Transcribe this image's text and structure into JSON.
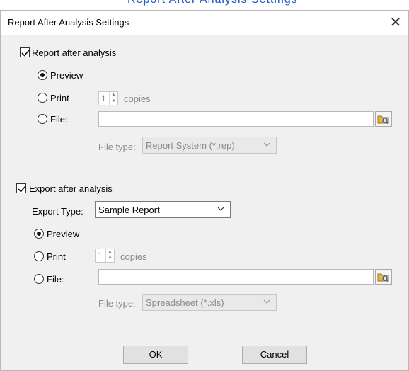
{
  "header_clip": "Report After Analysis Settings",
  "dialog": {
    "title": "Report After Analysis Settings",
    "close_glyph": "✕"
  },
  "report": {
    "checkbox_label": "Report after analysis",
    "checked": true,
    "preview_label": "Preview",
    "print_label": "Print",
    "copies_value": "1",
    "copies_label": "copies",
    "file_label": "File:",
    "file_value": "",
    "file_type_label": "File type:",
    "file_type_value": "Report System (*.rep)"
  },
  "export": {
    "checkbox_label": "Export after analysis",
    "checked": true,
    "export_type_label": "Export Type:",
    "export_type_value": "Sample Report",
    "preview_label": "Preview",
    "print_label": "Print",
    "copies_value": "1",
    "copies_label": "copies",
    "file_label": "File:",
    "file_value": "",
    "file_type_label": "File type:",
    "file_type_value": "Spreadsheet (*.xls)"
  },
  "buttons": {
    "ok": "OK",
    "cancel": "Cancel"
  },
  "icons": {
    "check": "check-icon",
    "browse": "folder-search-icon",
    "dropdown": "chevron-down-icon",
    "close": "close-icon"
  },
  "colors": {
    "window_bg": "#f0f0f0",
    "title_bg": "#ffffff",
    "disabled_text": "#8a8a8a",
    "header_clip_text": "#1a56c8"
  }
}
